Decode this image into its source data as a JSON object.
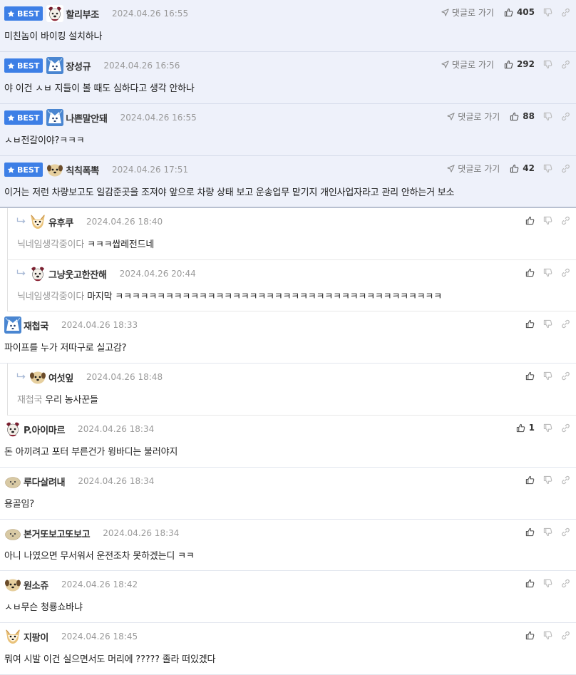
{
  "ui": {
    "best_label": "BEST",
    "goto_reply": "댓글로 가기"
  },
  "comments": [
    {
      "id": "c1",
      "best": true,
      "nick": "할리부조",
      "date": "2024.04.26 16:55",
      "text": "미친놈이 바이킹 설치하나",
      "likes": "405",
      "avatar": "dog"
    },
    {
      "id": "c2",
      "best": true,
      "nick": "장성규",
      "date": "2024.04.26 16:56",
      "text": "야 이건 ㅅㅂ 지들이 볼 때도 심하다고 생각 안하나",
      "likes": "292",
      "avatar": "blue"
    },
    {
      "id": "c3",
      "best": true,
      "nick": "나쁜말안돼",
      "date": "2024.04.26 16:55",
      "text": "ㅅㅂ전갈이야?ㅋㅋㅋ",
      "likes": "88",
      "avatar": "blue"
    },
    {
      "id": "c4",
      "best": true,
      "nick": "칙칙폭뽁",
      "date": "2024.04.26 17:51",
      "text": "이거는 저런 차량보고도 일감준곳을 조져야 앞으로 차량 상태 보고 운송업무 맡기지 개인사업자라고 관리 안하는거 보소",
      "likes": "42",
      "avatar": "tan"
    },
    {
      "id": "c5",
      "reply": true,
      "nick": "유후쿠",
      "date": "2024.04.26 18:40",
      "mention": "닉네임생각중이다",
      "text": "ㅋㅋㅋ쌉레전드네",
      "likes": "",
      "avatar": "fox"
    },
    {
      "id": "c6",
      "reply": true,
      "nick": "그냥웃고한잔해",
      "date": "2024.04.26 20:44",
      "mention": "닉네임생각중이다",
      "text": "마지막 ㅋㅋㅋㅋㅋㅋㅋㅋㅋㅋㅋㅋㅋㅋㅋㅋㅋㅋㅋㅋㅋㅋㅋㅋㅋㅋㅋㅋㅋㅋㅋㅋㅋㅋㅋㅋㅋㅋㅋ",
      "likes": "",
      "avatar": "dog"
    },
    {
      "id": "c7",
      "nick": "재첩국",
      "date": "2024.04.26 18:33",
      "text": "파이프를 누가 저따구로 실고감?",
      "likes": "",
      "avatar": "blue"
    },
    {
      "id": "c8",
      "reply": true,
      "nick": "여섯잎",
      "date": "2024.04.26 18:48",
      "mention": "재첩국",
      "text": "우리 농사꾼들",
      "likes": "",
      "avatar": "tan"
    },
    {
      "id": "c9",
      "nick": "P.아이마르",
      "date": "2024.04.26 18:34",
      "text": "돈 아끼려고 포터 부른건가 윙바디는 불러야지",
      "likes": "1",
      "avatar": "dog"
    },
    {
      "id": "c10",
      "nick": "루다살려내",
      "date": "2024.04.26 18:34",
      "text": "용골임?",
      "likes": "",
      "avatar": "blob"
    },
    {
      "id": "c11",
      "nick": "본거또보고또보고",
      "date": "2024.04.26 18:34",
      "text": "아니 나였으면 무서워서 운전조차 못하겠는디 ㅋㅋ",
      "likes": "",
      "avatar": "blob"
    },
    {
      "id": "c12",
      "nick": "원소쥬",
      "date": "2024.04.26 18:42",
      "text": "ㅅㅂ무슨 청룡쇼바냐",
      "likes": "",
      "avatar": "tan"
    },
    {
      "id": "c13",
      "nick": "지팡이",
      "date": "2024.04.26 18:45",
      "text": "뭐여 시발 이건 실으면서도 머리에 ????? 졸라 떠있겠다",
      "likes": "",
      "avatar": "fox"
    }
  ]
}
